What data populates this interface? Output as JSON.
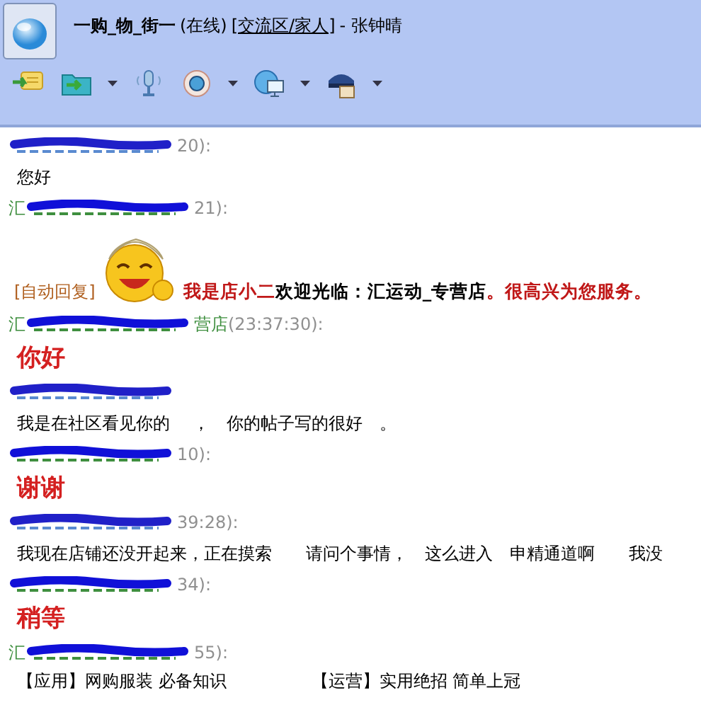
{
  "window": {
    "contact": "一购_物_街一",
    "status": "(在线)",
    "group": "[交流区/家人]",
    "owner": "- 张钟晴"
  },
  "toolbar": [
    {
      "kind": "chat"
    },
    {
      "kind": "file"
    },
    {
      "kind": "dropdown"
    },
    {
      "kind": "mic"
    },
    {
      "kind": "camera"
    },
    {
      "kind": "dropdown"
    },
    {
      "kind": "remote"
    },
    {
      "kind": "dropdown"
    },
    {
      "kind": "police"
    },
    {
      "kind": "dropdown"
    }
  ],
  "messages": [
    {
      "from_seller": false,
      "time_tail": "20):",
      "kind": "text",
      "text": "您好"
    },
    {
      "from_seller": true,
      "name_head": "汇",
      "time_tail": "21):",
      "kind": "auto",
      "label": "[自动回复]",
      "segments": [
        {
          "kind": "highlight",
          "text": "我是店小二"
        },
        {
          "kind": "plain",
          "text": "欢迎光临：汇运动_专营店"
        },
        {
          "kind": "highlight",
          "text": "。很高兴为您服务。"
        }
      ]
    },
    {
      "from_seller": true,
      "name_head": "汇",
      "name_tail": "营店",
      "time_tail": "(23:37:30):",
      "kind": "big",
      "text": "你好"
    },
    {
      "from_seller": false,
      "kind": "text",
      "text": "我是在社区看见你的　 ，　你的帖子写的很好　。"
    },
    {
      "from_seller": true,
      "time_tail": "10):",
      "kind": "big",
      "text": "谢谢"
    },
    {
      "from_seller": false,
      "time_tail": "39:28):",
      "kind": "text",
      "text": "我现在店铺还没开起来，正在摸索　　请问个事情，　这么进入　申精通道啊　　我没"
    },
    {
      "from_seller": true,
      "time_tail": "34):",
      "kind": "big",
      "text": "稍等"
    },
    {
      "from_seller": true,
      "name_head": "汇",
      "time_tail": "55):",
      "kind": "links",
      "links": [
        "【应用】网购服装 必备知识",
        "【运营】实用绝招 简单上冠"
      ]
    }
  ]
}
